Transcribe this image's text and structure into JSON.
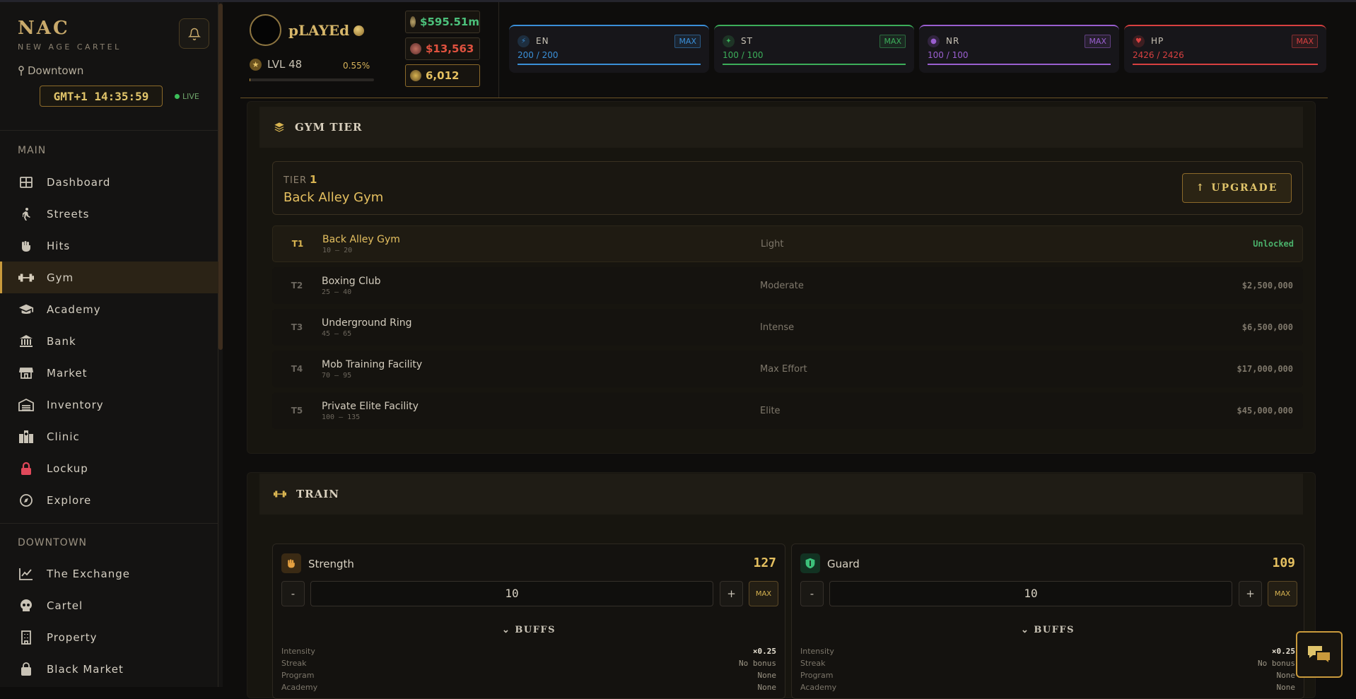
{
  "brand": {
    "title": "NAC",
    "subtitle": "NEW AGE CARTEL"
  },
  "location": "Downtown",
  "clock": "GMT+1 14:35:59",
  "live": "LIVE",
  "sections": {
    "main": "MAIN",
    "downtown": "DOWNTOWN"
  },
  "nav_main": [
    {
      "label": "Dashboard",
      "icon": "grid-icon"
    },
    {
      "label": "Streets",
      "icon": "walking-icon"
    },
    {
      "label": "Hits",
      "icon": "fist-icon"
    },
    {
      "label": "Gym",
      "icon": "dumbbell-icon",
      "active": true
    },
    {
      "label": "Academy",
      "icon": "graduation-cap-icon"
    },
    {
      "label": "Bank",
      "icon": "bank-icon"
    },
    {
      "label": "Market",
      "icon": "store-icon"
    },
    {
      "label": "Inventory",
      "icon": "warehouse-icon"
    },
    {
      "label": "Clinic",
      "icon": "hospital-icon"
    },
    {
      "label": "Lockup",
      "icon": "lock-icon"
    },
    {
      "label": "Explore",
      "icon": "compass-icon"
    }
  ],
  "nav_downtown": [
    {
      "label": "The Exchange",
      "icon": "chart-line-icon"
    },
    {
      "label": "Cartel",
      "icon": "skull-icon"
    },
    {
      "label": "Property",
      "icon": "building-icon"
    },
    {
      "label": "Black Market",
      "icon": "bag-icon"
    }
  ],
  "player": {
    "name": "pLAYEd",
    "level": "LVL 48",
    "xp_pct": "0.55%",
    "xp_fraction": 0.0055
  },
  "money": {
    "cash": "$595.51m",
    "dirty": "$13,563",
    "points": "6,012"
  },
  "stats": [
    {
      "key": "EN",
      "value": "200 / 200",
      "max": "MAX",
      "color": "#3a8fd8"
    },
    {
      "key": "ST",
      "value": "100 / 100",
      "max": "MAX",
      "color": "#3cae5a"
    },
    {
      "key": "NR",
      "value": "100 / 100",
      "max": "MAX",
      "color": "#9a5fd0"
    },
    {
      "key": "HP",
      "value": "2426 / 2426",
      "max": "MAX",
      "color": "#d84040"
    }
  ],
  "gym_tier": {
    "heading": "GYM TIER",
    "tier_label": "TIER",
    "tier_num": "1",
    "tier_name": "Back Alley Gym",
    "upgrade": "UPGRADE",
    "rows": [
      {
        "id": "T1",
        "name": "Back Alley Gym",
        "range": "10 – 20",
        "intensity": "Light",
        "price": "Unlocked"
      },
      {
        "id": "T2",
        "name": "Boxing Club",
        "range": "25 – 40",
        "intensity": "Moderate",
        "price": "$2,500,000"
      },
      {
        "id": "T3",
        "name": "Underground Ring",
        "range": "45 – 65",
        "intensity": "Intense",
        "price": "$6,500,000"
      },
      {
        "id": "T4",
        "name": "Mob Training Facility",
        "range": "70 – 95",
        "intensity": "Max Effort",
        "price": "$17,000,000"
      },
      {
        "id": "T5",
        "name": "Private Elite Facility",
        "range": "100 – 135",
        "intensity": "Elite",
        "price": "$45,000,000"
      }
    ]
  },
  "train": {
    "heading": "TRAIN",
    "cards": [
      {
        "name": "Strength",
        "value": "127",
        "qty": "10",
        "minus": "-",
        "plus": "+",
        "max": "MAX",
        "buffs": "BUFFS",
        "buff_rows": [
          {
            "k": "Intensity",
            "v": "×0.25"
          },
          {
            "k": "Streak",
            "v": "No bonus"
          },
          {
            "k": "Program",
            "v": "None"
          },
          {
            "k": "Academy",
            "v": "None"
          }
        ]
      },
      {
        "name": "Guard",
        "value": "109",
        "qty": "10",
        "minus": "-",
        "plus": "+",
        "max": "MAX",
        "buffs": "BUFFS",
        "buff_rows": [
          {
            "k": "Intensity",
            "v": "×0.25"
          },
          {
            "k": "Streak",
            "v": "No bonus"
          },
          {
            "k": "Program",
            "v": "None"
          },
          {
            "k": "Academy",
            "v": "None"
          }
        ]
      }
    ]
  }
}
